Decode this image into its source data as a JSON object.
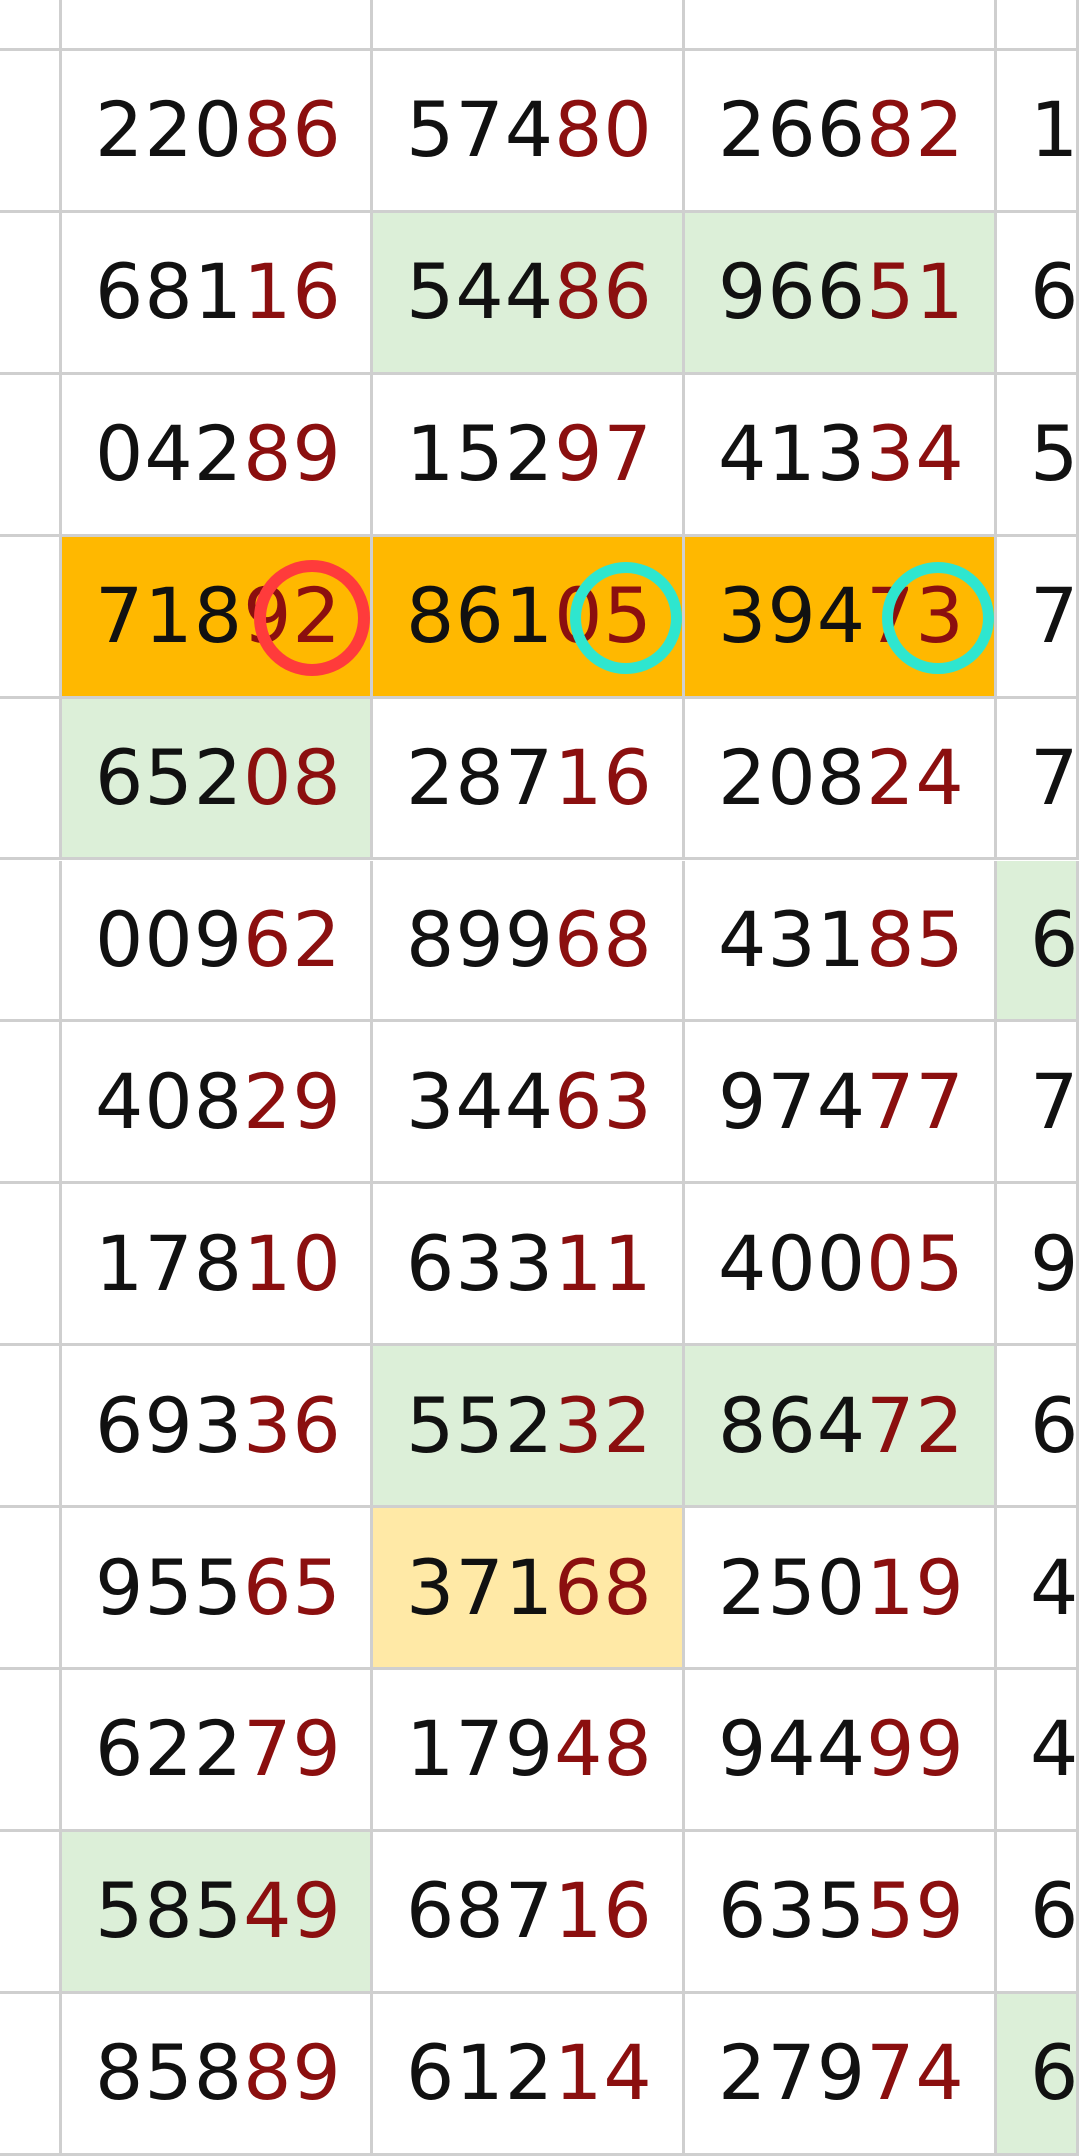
{
  "colors": {
    "grid_line": "#cfcfcf",
    "head_digits": "#111111",
    "tail_digits": "#8b0f0f",
    "green_fill": "#dcefd8",
    "orange_fill": "#ffb800",
    "light_yellow_fill": "#ffe9a6",
    "red_circle": "#ff3b3b",
    "teal_circle": "#2ee6cf"
  },
  "grid": {
    "rows": [
      {
        "cells": [
          {
            "head": "",
            "tail": "",
            "fill": "none"
          },
          {
            "head": "",
            "tail": "",
            "fill": "none"
          },
          {
            "head": "",
            "tail": "",
            "fill": "none"
          },
          {
            "head": "",
            "tail": "",
            "fill": "none"
          },
          {
            "head": "",
            "tail": "",
            "fill": "none"
          }
        ]
      },
      {
        "cells": [
          {
            "head": "",
            "tail": "",
            "fill": "none"
          },
          {
            "head": "220",
            "tail": "86",
            "fill": "none"
          },
          {
            "head": "574",
            "tail": "80",
            "fill": "none"
          },
          {
            "head": "266",
            "tail": "82",
            "fill": "none"
          },
          {
            "head": "1",
            "tail": "",
            "fill": "none"
          }
        ]
      },
      {
        "cells": [
          {
            "head": "",
            "tail": "",
            "fill": "none"
          },
          {
            "head": "681",
            "tail": "16",
            "fill": "none"
          },
          {
            "head": "544",
            "tail": "86",
            "fill": "green"
          },
          {
            "head": "966",
            "tail": "51",
            "fill": "green"
          },
          {
            "head": "6",
            "tail": "",
            "fill": "none"
          }
        ]
      },
      {
        "cells": [
          {
            "head": "",
            "tail": "",
            "fill": "none"
          },
          {
            "head": "042",
            "tail": "89",
            "fill": "none"
          },
          {
            "head": "152",
            "tail": "97",
            "fill": "none"
          },
          {
            "head": "413",
            "tail": "34",
            "fill": "none"
          },
          {
            "head": "5",
            "tail": "",
            "fill": "none"
          }
        ]
      },
      {
        "cells": [
          {
            "head": "",
            "tail": "",
            "fill": "none"
          },
          {
            "head": "718",
            "tail": "92",
            "fill": "orange",
            "circle": "red"
          },
          {
            "head": "861",
            "tail": "05",
            "fill": "orange",
            "circle": "teal"
          },
          {
            "head": "394",
            "tail": "73",
            "fill": "orange",
            "circle": "teal"
          },
          {
            "head": "7",
            "tail": "",
            "fill": "none"
          }
        ]
      },
      {
        "cells": [
          {
            "head": "",
            "tail": "",
            "fill": "none"
          },
          {
            "head": "652",
            "tail": "08",
            "fill": "green"
          },
          {
            "head": "287",
            "tail": "16",
            "fill": "none"
          },
          {
            "head": "208",
            "tail": "24",
            "fill": "none"
          },
          {
            "head": "7",
            "tail": "",
            "fill": "none"
          }
        ]
      },
      {
        "cells": [
          {
            "head": "",
            "tail": "",
            "fill": "none"
          },
          {
            "head": "009",
            "tail": "62",
            "fill": "none"
          },
          {
            "head": "899",
            "tail": "68",
            "fill": "none"
          },
          {
            "head": "431",
            "tail": "85",
            "fill": "none"
          },
          {
            "head": "6",
            "tail": "",
            "fill": "green"
          }
        ]
      },
      {
        "cells": [
          {
            "head": "",
            "tail": "",
            "fill": "none"
          },
          {
            "head": "408",
            "tail": "29",
            "fill": "none"
          },
          {
            "head": "344",
            "tail": "63",
            "fill": "none"
          },
          {
            "head": "974",
            "tail": "77",
            "fill": "none"
          },
          {
            "head": "7",
            "tail": "",
            "fill": "none"
          }
        ]
      },
      {
        "cells": [
          {
            "head": "",
            "tail": "",
            "fill": "none"
          },
          {
            "head": "178",
            "tail": "10",
            "fill": "none"
          },
          {
            "head": "633",
            "tail": "11",
            "fill": "none"
          },
          {
            "head": "400",
            "tail": "05",
            "fill": "none"
          },
          {
            "head": "9",
            "tail": "",
            "fill": "none"
          }
        ]
      },
      {
        "cells": [
          {
            "head": "",
            "tail": "",
            "fill": "none"
          },
          {
            "head": "693",
            "tail": "36",
            "fill": "none"
          },
          {
            "head": "552",
            "tail": "32",
            "fill": "green"
          },
          {
            "head": "864",
            "tail": "72",
            "fill": "green"
          },
          {
            "head": "6",
            "tail": "",
            "fill": "none"
          }
        ]
      },
      {
        "cells": [
          {
            "head": "",
            "tail": "",
            "fill": "none"
          },
          {
            "head": "955",
            "tail": "65",
            "fill": "none"
          },
          {
            "head": "371",
            "tail": "68",
            "fill": "lightyellow"
          },
          {
            "head": "250",
            "tail": "19",
            "fill": "none"
          },
          {
            "head": "4",
            "tail": "",
            "fill": "none"
          }
        ]
      },
      {
        "cells": [
          {
            "head": "",
            "tail": "",
            "fill": "none"
          },
          {
            "head": "622",
            "tail": "79",
            "fill": "none"
          },
          {
            "head": "179",
            "tail": "48",
            "fill": "none"
          },
          {
            "head": "944",
            "tail": "99",
            "fill": "none"
          },
          {
            "head": "4",
            "tail": "",
            "fill": "none"
          }
        ]
      },
      {
        "cells": [
          {
            "head": "",
            "tail": "",
            "fill": "none"
          },
          {
            "head": "585",
            "tail": "49",
            "fill": "green"
          },
          {
            "head": "687",
            "tail": "16",
            "fill": "none"
          },
          {
            "head": "635",
            "tail": "59",
            "fill": "none"
          },
          {
            "head": "6",
            "tail": "",
            "fill": "none"
          }
        ]
      },
      {
        "cells": [
          {
            "head": "",
            "tail": "",
            "fill": "none"
          },
          {
            "head": "858",
            "tail": "89",
            "fill": "none"
          },
          {
            "head": "612",
            "tail": "14",
            "fill": "none"
          },
          {
            "head": "279",
            "tail": "74",
            "fill": "none"
          },
          {
            "head": "6",
            "tail": "",
            "fill": "green"
          }
        ]
      }
    ]
  }
}
